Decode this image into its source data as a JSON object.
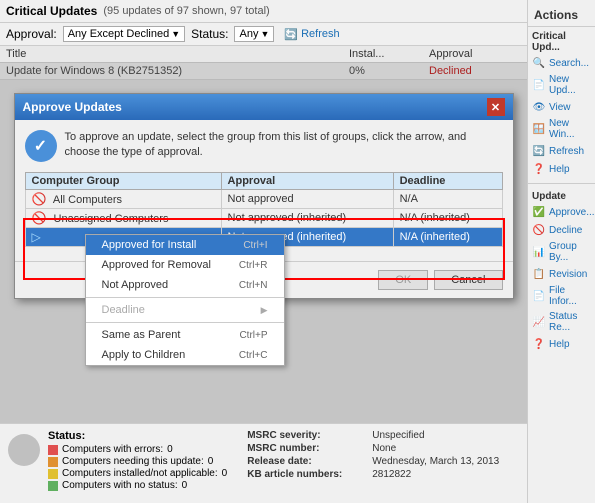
{
  "window": {
    "title": "Critical Updates",
    "count_label": "(95 updates of 97 shown, 97 total)"
  },
  "filter_bar": {
    "approval_label": "Approval:",
    "approval_value": "Any Except Declined",
    "status_label": "Status:",
    "status_value": "Any",
    "refresh_label": "Refresh"
  },
  "columns": {
    "title": "Title",
    "install": "Instal...",
    "approval": "Approval"
  },
  "update_row": {
    "title": "Update for Windows 8 (KB2751352)",
    "pct": "0%",
    "approval": "Declined"
  },
  "modal": {
    "title": "Approve Updates",
    "description": "To approve an update, select the group from this list of groups, click the arrow, and choose the type of approval.",
    "columns": [
      "Computer Group",
      "Approval",
      "Deadline"
    ],
    "rows": [
      {
        "group": "All Computers",
        "approval": "Not approved",
        "deadline": "N/A"
      },
      {
        "group": "Unassigned Computers",
        "approval": "Not approved (inherited)",
        "deadline": "N/A (inherited)"
      },
      {
        "group": "",
        "approval": "Not approved (inherited)",
        "deadline": "N/A (inherited)"
      }
    ],
    "ok_label": "OK",
    "cancel_label": "Cancel"
  },
  "context_menu": {
    "items": [
      {
        "label": "Approved for Install",
        "shortcut": "Ctrl+I",
        "selected": true
      },
      {
        "label": "Approved for Removal",
        "shortcut": "Ctrl+R"
      },
      {
        "label": "Not Approved",
        "shortcut": "Ctrl+N"
      },
      {
        "label": "Deadline",
        "submenu": true,
        "disabled": true
      },
      {
        "label": "Same as Parent",
        "shortcut": "Ctrl+P"
      },
      {
        "label": "Apply to Children",
        "shortcut": "Ctrl+C"
      }
    ]
  },
  "status": {
    "label": "Status:",
    "items": [
      {
        "color": "red",
        "label": "Computers with errors:",
        "value": "0"
      },
      {
        "color": "orange",
        "label": "Computers needing this update:",
        "value": "0"
      },
      {
        "color": "yellow",
        "label": "Computers installed/not applicable:",
        "value": "0"
      },
      {
        "color": "green",
        "label": "Computers with no status:",
        "value": "0"
      }
    ],
    "msrc_severity_label": "MSRC severity:",
    "msrc_severity_value": "Unspecified",
    "msrc_number_label": "MSRC number:",
    "msrc_number_value": "None",
    "release_date_label": "Release date:",
    "release_date_value": "Wednesday, March 13, 2013",
    "kb_article_label": "KB article numbers:",
    "kb_article_value": "2812822"
  },
  "sidebar": {
    "title": "Actions",
    "sections": [
      {
        "title": "Critical Upd...",
        "items": [
          {
            "label": "Search...",
            "icon": "🔍"
          },
          {
            "label": "New Upd...",
            "icon": "📄"
          },
          {
            "label": "View",
            "icon": "👁"
          },
          {
            "label": "New Win...",
            "icon": "🪟"
          },
          {
            "label": "Refresh",
            "icon": "🔄"
          },
          {
            "label": "Help",
            "icon": "❓"
          }
        ]
      },
      {
        "title": "Update",
        "items": [
          {
            "label": "Approve...",
            "icon": "✅"
          },
          {
            "label": "Decline",
            "icon": "🚫"
          },
          {
            "label": "Group By...",
            "icon": "📊"
          },
          {
            "label": "Revision",
            "icon": "📋"
          },
          {
            "label": "File Infor...",
            "icon": "📄"
          },
          {
            "label": "Status Re...",
            "icon": "📈"
          },
          {
            "label": "Help",
            "icon": "❓"
          }
        ]
      }
    ]
  }
}
